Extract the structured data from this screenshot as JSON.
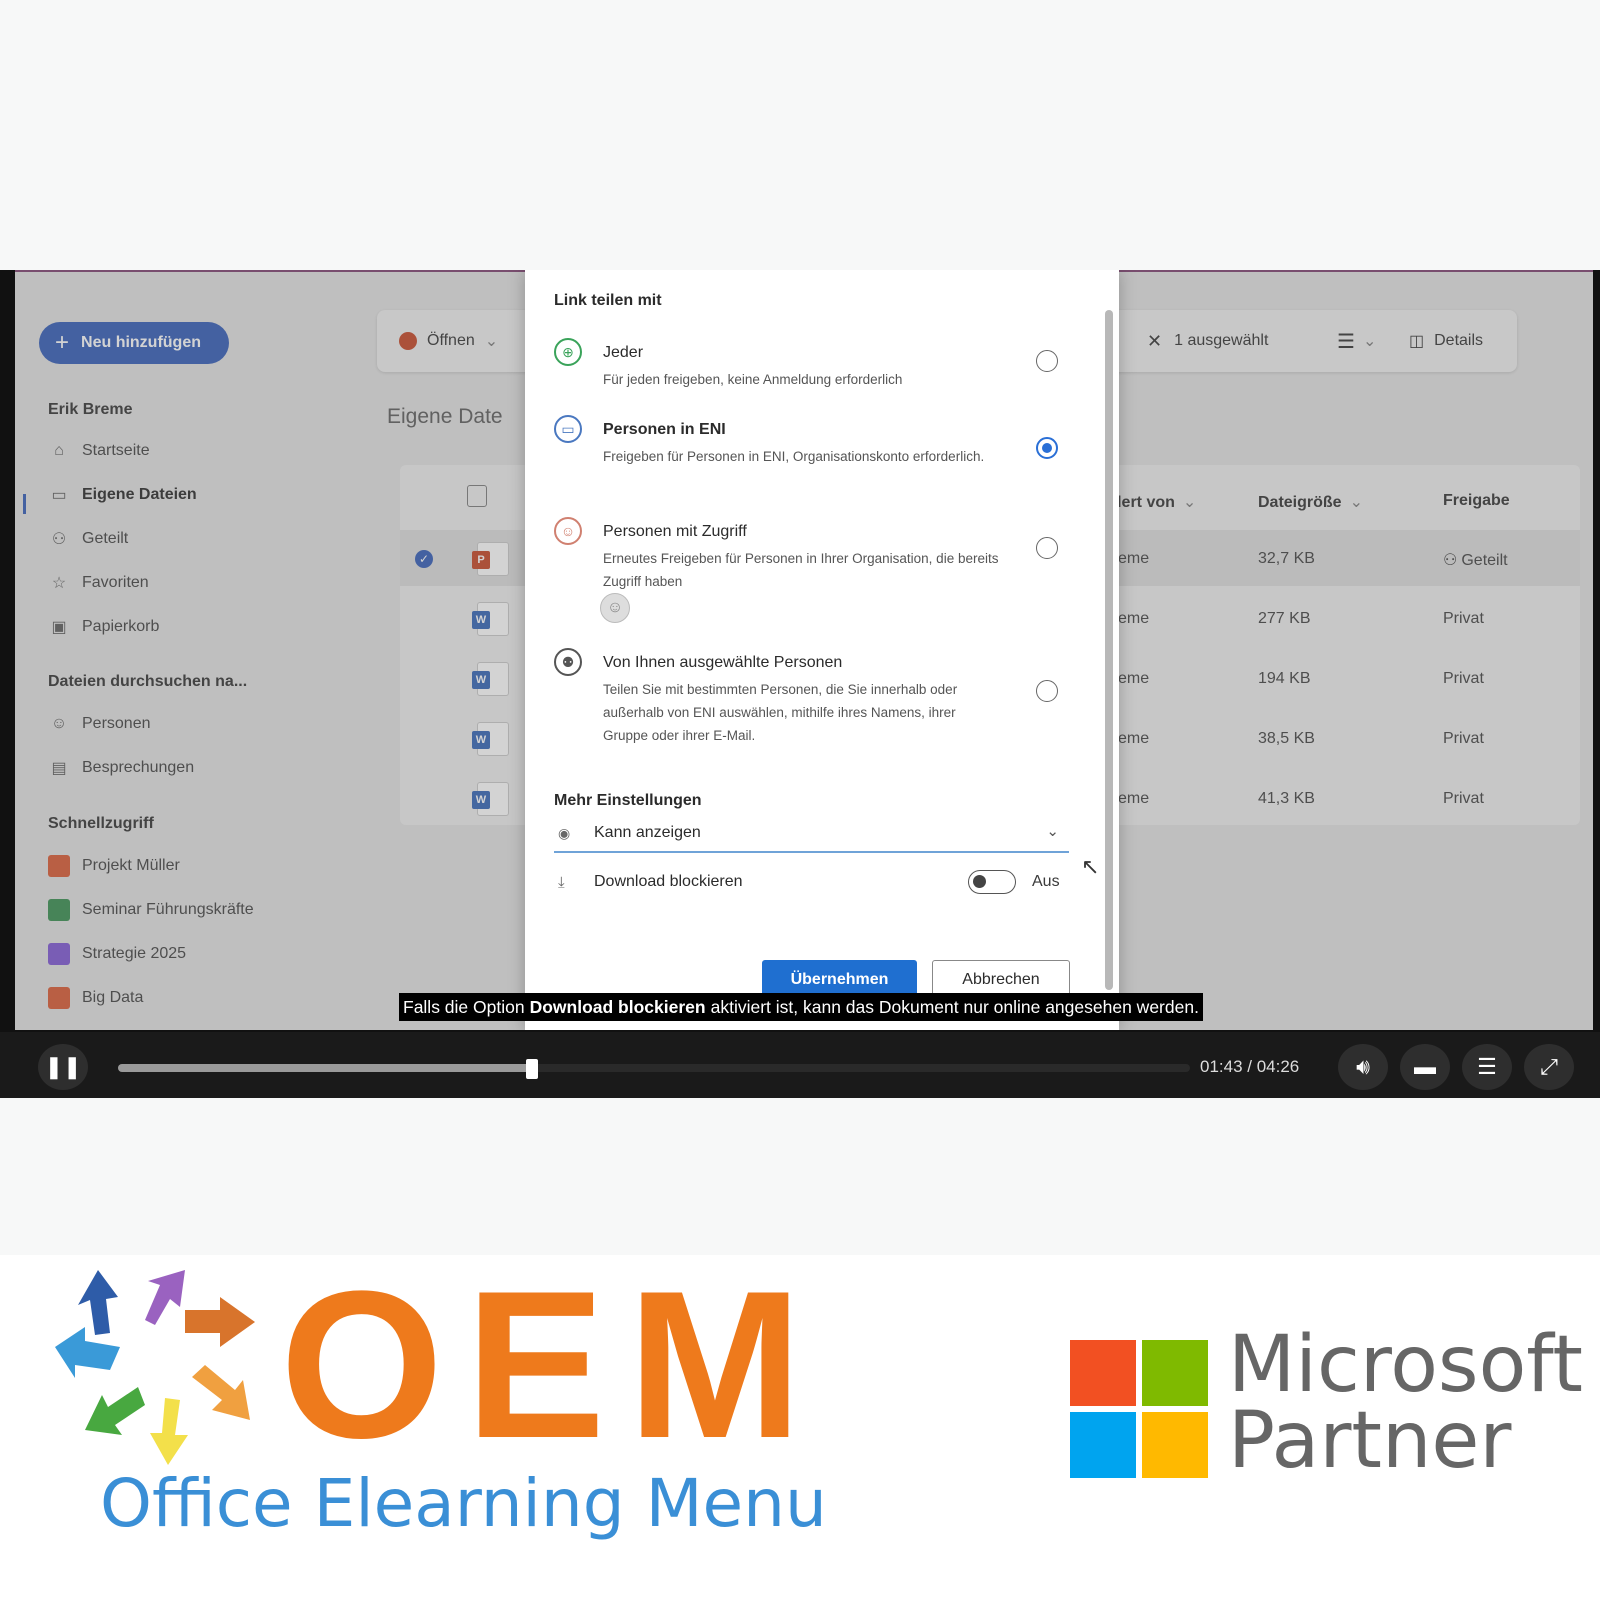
{
  "sidebar": {
    "new_button": "Neu hinzufügen",
    "user_name": "Erik Breme",
    "nav": [
      "Startseite",
      "Eigene Dateien",
      "Geteilt",
      "Favoriten",
      "Papierkorb"
    ],
    "browse_heading": "Dateien durchsuchen na...",
    "browse": [
      "Personen",
      "Besprechungen"
    ],
    "quick_heading": "Schnellzugriff",
    "quick": [
      {
        "label": "Projekt Müller",
        "color": "#d9532b"
      },
      {
        "label": "Seminar Führungskräfte",
        "color": "#2f8a48"
      },
      {
        "label": "Strategie 2025",
        "color": "#7a4fd3"
      },
      {
        "label": "Big Data",
        "color": "#d9532b"
      }
    ]
  },
  "toolbar": {
    "open": "Öffnen",
    "selected": "1 ausgewählt",
    "details": "Details"
  },
  "section_title": "Eigene Date",
  "columns": {
    "modified_by": "ndert von",
    "size": "Dateigröße",
    "sharing": "Freigabe"
  },
  "files": [
    {
      "modified_by": "Breme",
      "size": "32,7 KB",
      "sharing": "Geteilt",
      "type": "P",
      "tag_color": "#c43e1c"
    },
    {
      "modified_by": "Breme",
      "size": "277 KB",
      "sharing": "Privat",
      "type": "W",
      "tag_color": "#2b5fb4"
    },
    {
      "modified_by": "Breme",
      "size": "194 KB",
      "sharing": "Privat",
      "type": "W",
      "tag_color": "#2b5fb4"
    },
    {
      "modified_by": "Breme",
      "size": "38,5 KB",
      "sharing": "Privat",
      "type": "W",
      "tag_color": "#2b5fb4"
    },
    {
      "modified_by": "Breme",
      "size": "41,3 KB",
      "sharing": "Privat",
      "type": "W",
      "tag_color": "#2b5fb4"
    }
  ],
  "dialog": {
    "title": "Link teilen mit",
    "options": [
      {
        "title": "Jeder",
        "desc": "Für jeden freigeben, keine Anmeldung erforderlich",
        "selected": false
      },
      {
        "title": "Personen in ENI",
        "desc": "Freigeben für Personen in ENI, Organisationskonto erforderlich.",
        "selected": true
      },
      {
        "title": "Personen mit Zugriff",
        "desc": "Erneutes Freigeben für Personen in Ihrer Organisation, die bereits Zugriff haben",
        "selected": false
      },
      {
        "title": "Von Ihnen ausgewählte Personen",
        "desc": "Teilen Sie mit bestimmten Personen, die Sie innerhalb oder außerhalb von ENI auswählen, mithilfe ihres Namens, ihrer Gruppe oder ihrer E-Mail.",
        "selected": false
      }
    ],
    "more_settings": "Mehr Einstellungen",
    "permission": "Kann anzeigen",
    "download_block": "Download blockieren",
    "toggle_state": "Aus",
    "apply": "Übernehmen",
    "cancel": "Abbrechen"
  },
  "caption": {
    "before": "Falls die Option",
    "bold": "Download blockieren",
    "after": "aktiviert ist, kann das Dokument nur online angesehen werden."
  },
  "player": {
    "time": "01:43 / 04:26",
    "progress": 0.386
  },
  "branding": {
    "oem": "OEM",
    "oem_sub": "Office Elearning Menu",
    "ms_line1": "Microsoft",
    "ms_line2": "Partner",
    "ms_colors": [
      "#f25022",
      "#7fba00",
      "#00a4ef",
      "#ffb900"
    ]
  }
}
